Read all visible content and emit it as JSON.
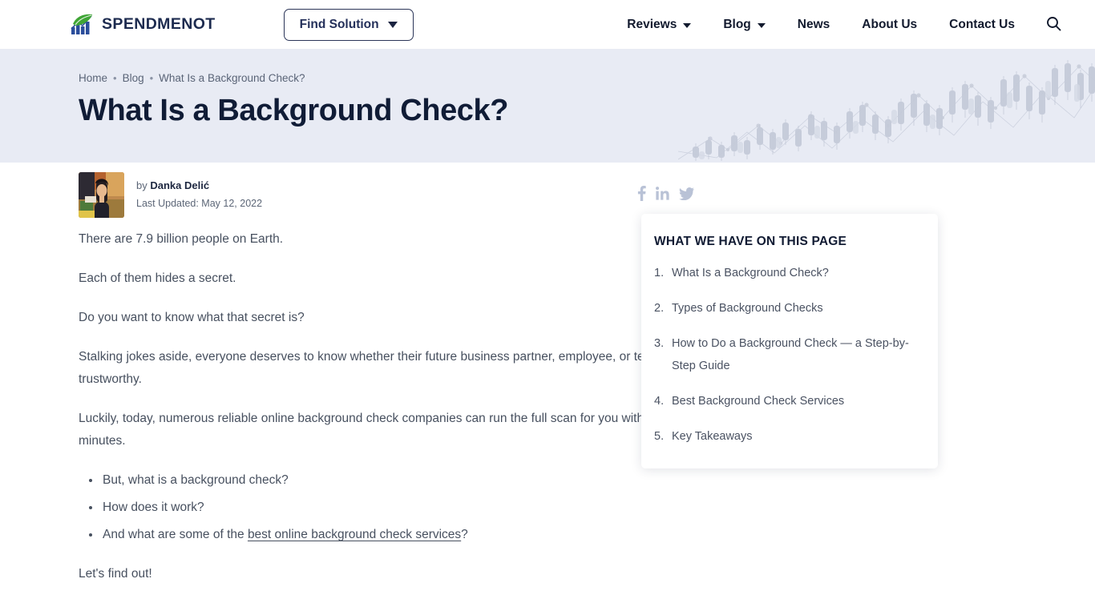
{
  "header": {
    "brand": {
      "name": "SPENDMENOT",
      "icon": "spendmenot-logo-icon"
    },
    "find_solution": {
      "label": "Find Solution",
      "caret_icon": "caret-down-icon"
    },
    "nav": [
      {
        "label": "Reviews",
        "has_dropdown": true
      },
      {
        "label": "Blog",
        "has_dropdown": true
      },
      {
        "label": "News",
        "has_dropdown": false
      },
      {
        "label": "About Us",
        "has_dropdown": false
      },
      {
        "label": "Contact Us",
        "has_dropdown": false
      }
    ],
    "search": {
      "icon": "search-icon",
      "label": "Search"
    }
  },
  "hero": {
    "breadcrumb": [
      {
        "label": "Home",
        "link": true
      },
      {
        "label": "Blog",
        "link": true
      },
      {
        "label": "What Is a Background Check?",
        "link": false
      }
    ],
    "separator": "•",
    "title": "What Is a Background Check?",
    "background_graphic": "candlestick-chart-watermark"
  },
  "byline": {
    "avatar_alt": "Author photo",
    "by_prefix": "by ",
    "author": "Danka Delić",
    "updated": "Last Updated: May 12, 2022",
    "share": [
      {
        "name": "facebook-icon",
        "label": "Share on Facebook"
      },
      {
        "name": "linkedin-icon",
        "label": "Share on LinkedIn"
      },
      {
        "name": "twitter-icon",
        "label": "Share on Twitter"
      }
    ]
  },
  "article": {
    "paragraphs": [
      "There are 7.9 billion people on Earth.",
      "Each of them hides a secret.",
      "Do you want to know what that secret is?",
      "Stalking jokes aside, everyone deserves to know whether their future business partner, employee, or tenant is trustworthy.",
      "Luckily, today, numerous reliable online background check companies can run the full scan for you within minutes."
    ],
    "bullets": [
      {
        "text": "But, what is a background check?"
      },
      {
        "text": "How does it work?"
      }
    ],
    "bullet_link_item": {
      "before": "And what are some of the ",
      "link": "best online background check services",
      "after": "?"
    },
    "closing": "Let's find out!"
  },
  "toc": {
    "title": "WHAT WE HAVE ON THIS PAGE",
    "items": [
      "What Is a Background Check?",
      "Types of Background Checks",
      "How to Do a Background Check — a Step-by-Step Guide",
      "Best Background Check Services",
      "Key Takeaways"
    ]
  },
  "colors": {
    "hero_bg": "#e8ebf4",
    "title": "#101c36",
    "body_text": "#47505f",
    "brand_navy": "#1d2b4f",
    "logo_green": "#3fa535",
    "logo_blue": "#2a4d9b"
  }
}
